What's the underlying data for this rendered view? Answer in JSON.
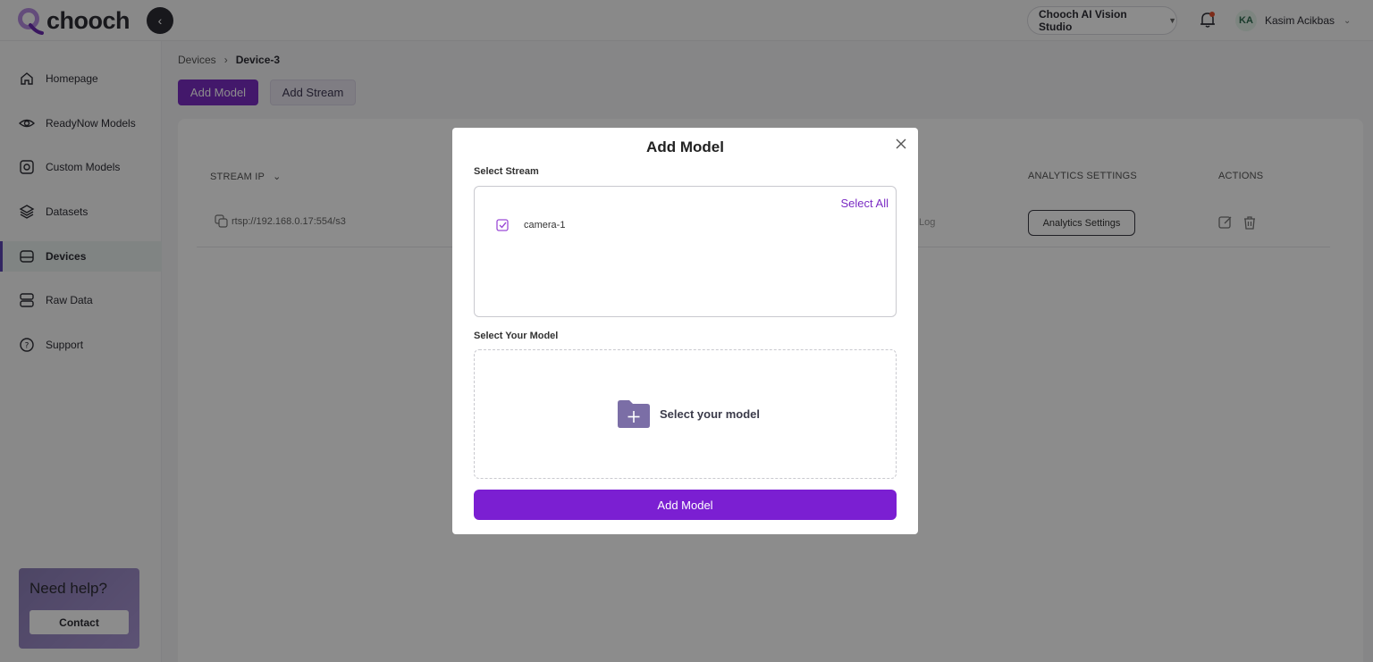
{
  "brand": {
    "name": "chooch"
  },
  "header": {
    "studio_select": "Chooch AI Vision Studio",
    "user_initials": "KA",
    "user_name": "Kasim Acikbas"
  },
  "sidebar": {
    "items": [
      {
        "label": "Homepage",
        "icon": "home-icon"
      },
      {
        "label": "ReadyNow Models",
        "icon": "eye-icon"
      },
      {
        "label": "Custom Models",
        "icon": "custom-model-icon"
      },
      {
        "label": "Datasets",
        "icon": "layers-icon"
      },
      {
        "label": "Devices",
        "icon": "device-icon",
        "active": true
      },
      {
        "label": "Raw Data",
        "icon": "database-icon"
      },
      {
        "label": "Support",
        "icon": "help-circle-icon"
      }
    ],
    "help": {
      "title": "Need help?",
      "button": "Contact"
    }
  },
  "breadcrumb": {
    "parent": "Devices",
    "current": "Device-3"
  },
  "toolbar": {
    "add_model": "Add Model",
    "add_stream": "Add Stream"
  },
  "table": {
    "headers": {
      "stream_ip": "STREAM IP",
      "analytics_settings": "ANALYTICS SETTINGS",
      "actions": "ACTIONS"
    },
    "row": {
      "stream_ip": "rtsp://192.168.0.17:554/s3",
      "log": "Log",
      "analytics_button": "Analytics Settings"
    }
  },
  "modal": {
    "title": "Add Model",
    "select_stream_label": "Select Stream",
    "select_all": "Select All",
    "streams": [
      {
        "name": "camera-1",
        "checked": true
      }
    ],
    "select_model_label": "Select Your Model",
    "select_model_placeholder": "Select your model",
    "submit": "Add Model"
  },
  "colors": {
    "accent": "#7b2cc4",
    "active_nav_bg": "#e9f1ef"
  }
}
